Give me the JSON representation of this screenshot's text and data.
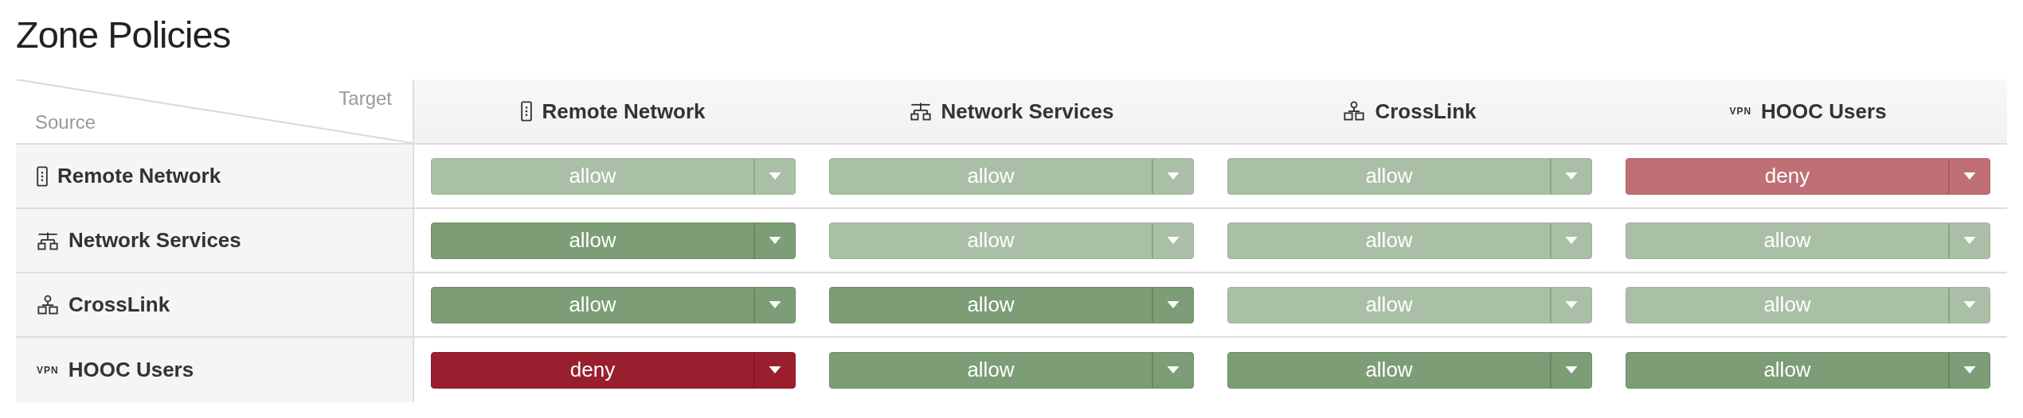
{
  "title": "Zone Policies",
  "corner": {
    "target_label": "Target",
    "source_label": "Source"
  },
  "columns": [
    {
      "label": "Remote Network",
      "kind": "device"
    },
    {
      "label": "Network Services",
      "kind": "services"
    },
    {
      "label": "CrossLink",
      "kind": "crosslink"
    },
    {
      "label": "HOOC Users",
      "kind": "vpn",
      "icon_text": "VPN"
    }
  ],
  "rows": [
    {
      "label": "Remote Network",
      "kind": "device",
      "policies": [
        {
          "value": "allow",
          "kind": "allow",
          "explicit": false
        },
        {
          "value": "allow",
          "kind": "allow",
          "explicit": false
        },
        {
          "value": "allow",
          "kind": "allow",
          "explicit": false
        },
        {
          "value": "deny",
          "kind": "deny",
          "explicit": false
        }
      ]
    },
    {
      "label": "Network Services",
      "kind": "services",
      "policies": [
        {
          "value": "allow",
          "kind": "allow",
          "explicit": true
        },
        {
          "value": "allow",
          "kind": "allow",
          "explicit": false
        },
        {
          "value": "allow",
          "kind": "allow",
          "explicit": false
        },
        {
          "value": "allow",
          "kind": "allow",
          "explicit": false
        }
      ]
    },
    {
      "label": "CrossLink",
      "kind": "crosslink",
      "policies": [
        {
          "value": "allow",
          "kind": "allow",
          "explicit": true
        },
        {
          "value": "allow",
          "kind": "allow",
          "explicit": true
        },
        {
          "value": "allow",
          "kind": "allow",
          "explicit": false
        },
        {
          "value": "allow",
          "kind": "allow",
          "explicit": false
        }
      ]
    },
    {
      "label": "HOOC Users",
      "kind": "vpn",
      "icon_text": "VPN",
      "policies": [
        {
          "value": "deny",
          "kind": "deny",
          "explicit": true
        },
        {
          "value": "allow",
          "kind": "allow",
          "explicit": true
        },
        {
          "value": "allow",
          "kind": "allow",
          "explicit": true
        },
        {
          "value": "allow",
          "kind": "allow",
          "explicit": true
        }
      ]
    }
  ]
}
